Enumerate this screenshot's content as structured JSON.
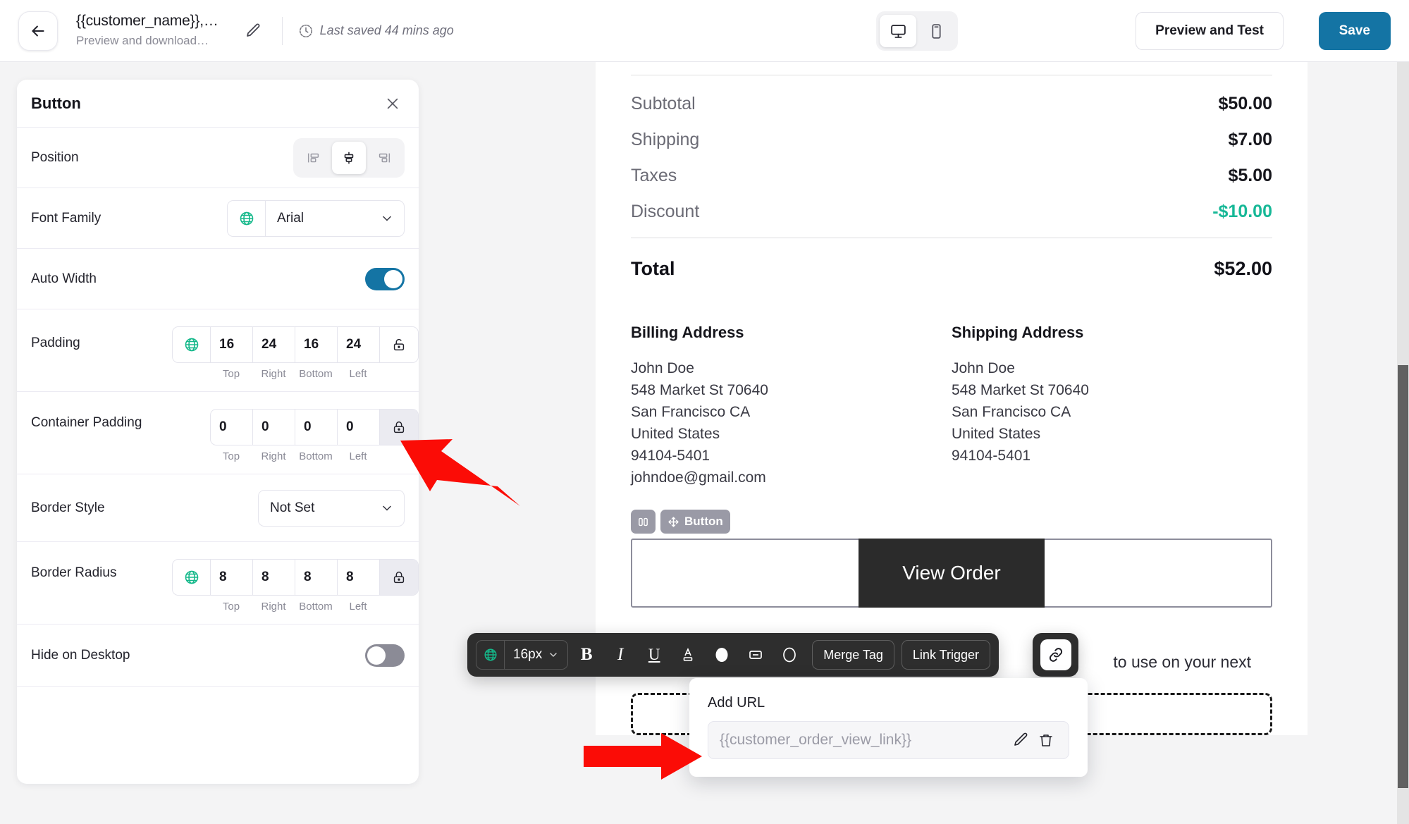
{
  "header": {
    "back_icon": "arrow-left-icon",
    "title": "{{customer_name}},…",
    "subtitle": "Preview and download…",
    "edit_icon": "pencil-icon",
    "clock_icon": "clock-icon",
    "saved_status": "Last saved 44 mins ago",
    "device_desktop_icon": "desktop-icon",
    "device_mobile_icon": "mobile-icon",
    "preview_button": "Preview and Test",
    "save_button": "Save",
    "save_button_color": "#1474a4"
  },
  "settings_panel": {
    "title": "Button",
    "close_icon": "close-icon",
    "position": {
      "label": "Position",
      "options": [
        {
          "name": "align-left-icon",
          "active": false
        },
        {
          "name": "align-center-icon",
          "active": true
        },
        {
          "name": "align-right-icon",
          "active": false
        }
      ]
    },
    "font_family": {
      "label": "Font Family",
      "globe_icon": "globe-icon",
      "value": "Arial",
      "chevron_icon": "chevron-down-icon"
    },
    "auto_width": {
      "label": "Auto Width",
      "value": "on"
    },
    "padding": {
      "label": "Padding",
      "globe_icon": "globe-icon",
      "values": [
        "16",
        "24",
        "16",
        "24"
      ],
      "sides": [
        "Top",
        "Right",
        "Bottom",
        "Left"
      ],
      "lock_icon": "unlock-icon",
      "lock_pressed": false
    },
    "container_padding": {
      "label": "Container Padding",
      "values": [
        "0",
        "0",
        "0",
        "0"
      ],
      "sides": [
        "Top",
        "Right",
        "Bottom",
        "Left"
      ],
      "lock_icon": "lock-icon",
      "lock_pressed": true
    },
    "border_style": {
      "label": "Border Style",
      "value": "Not Set",
      "chevron_icon": "chevron-down-icon"
    },
    "border_radius": {
      "label": "Border Radius",
      "globe_icon": "globe-icon",
      "values": [
        "8",
        "8",
        "8",
        "8"
      ],
      "sides": [
        "Top",
        "Right",
        "Bottom",
        "Left"
      ],
      "lock_icon": "lock-icon",
      "lock_pressed": true
    },
    "hide_on_desktop": {
      "label": "Hide on Desktop",
      "value": "off"
    }
  },
  "email_preview": {
    "totals": [
      {
        "label": "Subtotal",
        "value": "$50.00",
        "accent": false
      },
      {
        "label": "Shipping",
        "value": "$7.00",
        "accent": false
      },
      {
        "label": "Taxes",
        "value": "$5.00",
        "accent": false
      },
      {
        "label": "Discount",
        "value": "-$10.00",
        "accent": true
      }
    ],
    "discount_color": "#17b897",
    "total": {
      "label": "Total",
      "value": "$52.00"
    },
    "billing": {
      "title": "Billing Address",
      "lines": [
        "John Doe",
        "548 Market St 70640",
        "San Francisco CA",
        "United States",
        "94104-5401",
        "johndoe@gmail.com"
      ]
    },
    "shipping": {
      "title": "Shipping Address",
      "lines": [
        "John Doe",
        "548 Market St 70640",
        "San Francisco CA",
        "United States",
        "94104-5401"
      ]
    },
    "selection_badges": {
      "columns_icon": "columns-icon",
      "move_icon": "move-icon",
      "label": "Button"
    },
    "cta_button_label": "View Order",
    "trailing_copy": "to use on your next"
  },
  "format_toolbar": {
    "globe_icon": "globe-icon",
    "font_size": "16px",
    "chevron_icon": "chevron-down-icon",
    "bold": "B",
    "italic": "I",
    "underline": "U",
    "text_color_icon": "text-color-icon",
    "fill_color_icon": "fill-color-circle-icon",
    "border_icon": "border-icon",
    "shape_icon": "shape-circle-icon",
    "merge_tag": "Merge Tag",
    "link_trigger": "Link Trigger",
    "link_icon": "link-icon"
  },
  "url_popover": {
    "label": "Add URL",
    "value": "{{customer_order_view_link}}",
    "edit_icon": "pencil-icon",
    "delete_icon": "trash-icon"
  },
  "annotations": {
    "arrow_color": "#fb0c06",
    "arrow_1_target": "container-padding-lock-button",
    "arrow_2_target": "url-value-field"
  }
}
